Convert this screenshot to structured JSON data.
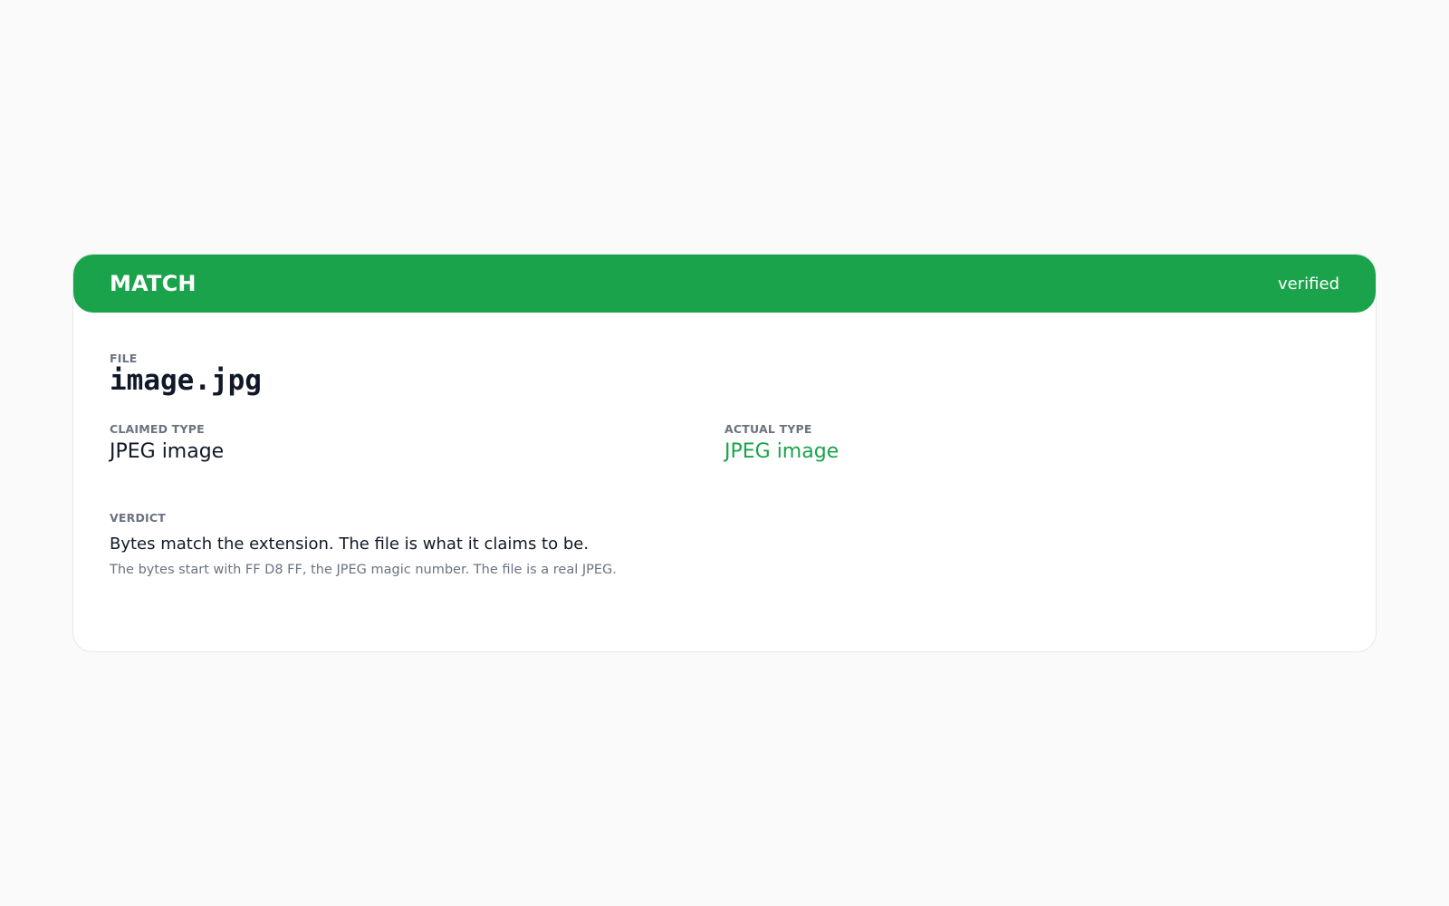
{
  "status": {
    "title": "MATCH",
    "badge": "verified",
    "color": "#1aa34a"
  },
  "file": {
    "label": "FILE",
    "name": "image.jpg"
  },
  "claimed": {
    "label": "CLAIMED TYPE",
    "value": "JPEG image"
  },
  "actual": {
    "label": "ACTUAL TYPE",
    "value": "JPEG image",
    "color": "#1aa34a"
  },
  "verdict": {
    "label": "VERDICT",
    "summary": "Bytes match the extension. The file is what it claims to be.",
    "detail": "The bytes start with FF D8 FF, the JPEG magic number. The file is a real JPEG."
  }
}
